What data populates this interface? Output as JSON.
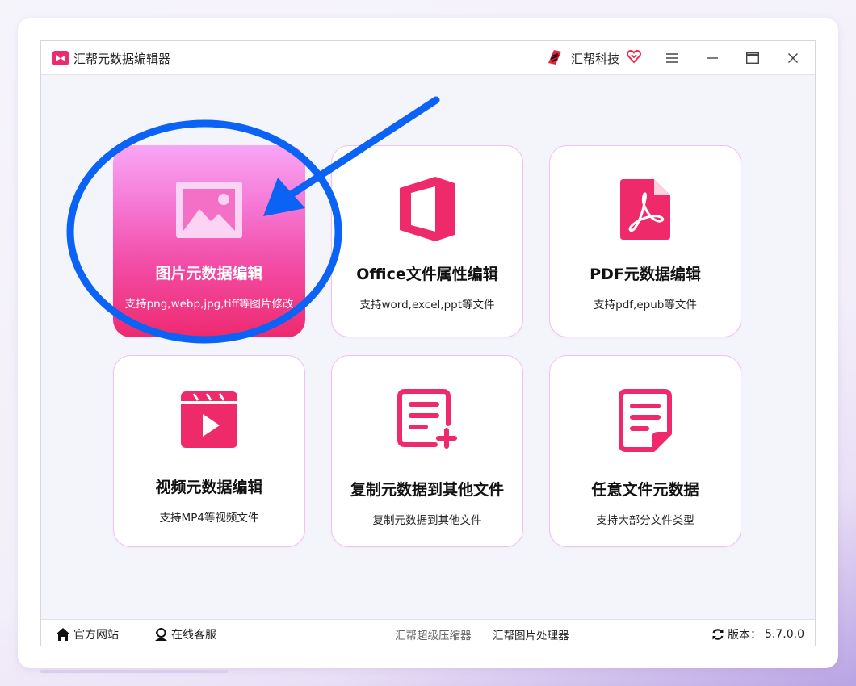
{
  "window": {
    "title": "汇帮元数据编辑器",
    "brand_name": "汇帮科技"
  },
  "tiles": [
    {
      "title": "图片元数据编辑",
      "desc": "支持png,webp,jpg,tiff等图片修改",
      "icon": "image-icon",
      "active": true
    },
    {
      "title": "Office文件属性编辑",
      "desc": "支持word,excel,ppt等文件",
      "icon": "office-icon",
      "active": false
    },
    {
      "title": "PDF元数据编辑",
      "desc": "支持pdf,epub等文件",
      "icon": "pdf-icon",
      "active": false
    },
    {
      "title": "视频元数据编辑",
      "desc": "支持MP4等视频文件",
      "icon": "video-icon",
      "active": false
    },
    {
      "title": "复制元数据到其他文件",
      "desc": "复制元数据到其他文件",
      "icon": "copy-list-icon",
      "active": false
    },
    {
      "title": "任意文件元数据",
      "desc": "支持大部分文件类型",
      "icon": "document-icon",
      "active": false
    }
  ],
  "statusbar": {
    "website": "官方网站",
    "support": "在线客服",
    "compressor": "汇帮超级压缩器",
    "image_processor": "汇帮图片处理器",
    "version_label": "版本：",
    "version": "5.7.0.0"
  },
  "annotation": {
    "highlight_color": "#0a63f5"
  },
  "colors": {
    "accent": "#ef2a6a",
    "tile_border": "#f0c2ee",
    "active_gradient_top": "#f9a6f6",
    "active_gradient_bottom": "#ee2a6f"
  }
}
